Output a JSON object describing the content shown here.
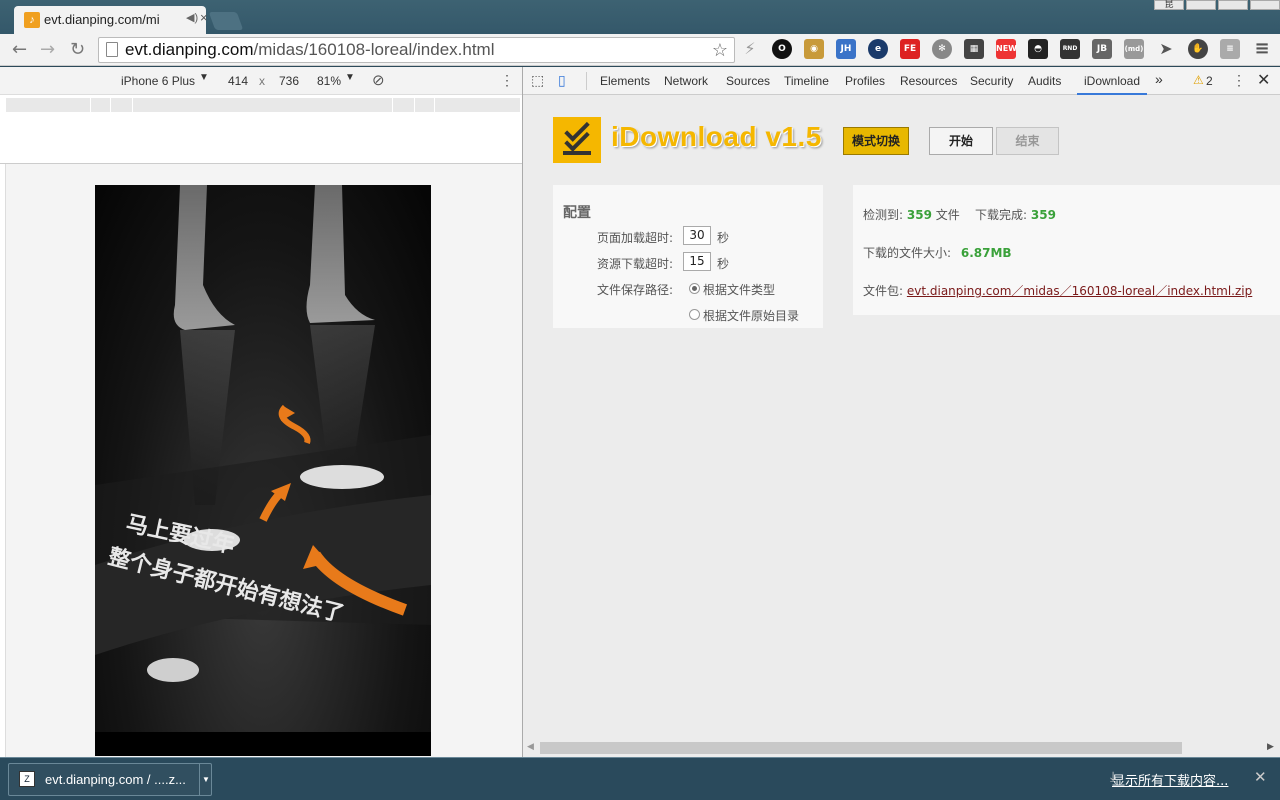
{
  "browser": {
    "tab_title": "evt.dianping.com/mi",
    "url_host": "evt.dianping.com",
    "url_path": "/midas/160108-loreal/index.html",
    "window_label": "昆"
  },
  "device_toolbar": {
    "device": "iPhone 6 Plus",
    "width": "414",
    "times": "x",
    "height": "736",
    "zoom": "81%"
  },
  "phone_content": {
    "line1": "马上要过年",
    "line2": "整个身子都开始有想法了"
  },
  "devtools": {
    "tabs": [
      "Elements",
      "Network",
      "Sources",
      "Timeline",
      "Profiles",
      "Resources",
      "Security",
      "Audits",
      "iDownload"
    ],
    "warning_count": "2"
  },
  "idownload": {
    "title": "iDownload v1.5",
    "mode_button": "模式切换",
    "start_button": "开始",
    "stop_button": "结束",
    "config": {
      "heading": "配置",
      "page_timeout_label": "页面加载超时:",
      "page_timeout_value": "30",
      "unit": "秒",
      "resource_timeout_label": "资源下载超时:",
      "resource_timeout_value": "15",
      "save_path_label": "文件保存路径:",
      "option_by_type": "根据文件类型",
      "option_by_original": "根据文件原始目录"
    },
    "status": {
      "detected_label": "检测到:",
      "detected_count": "359",
      "detected_unit": "文件",
      "done_label": "下载完成:",
      "done_count": "359",
      "size_label": "下载的文件大小:",
      "size_value": "6.87MB",
      "package_label": "文件包:",
      "package_link": "evt.dianping.com／midas／160108-loreal／index.html.zip"
    }
  },
  "download_shelf": {
    "item_name": "evt.dianping.com / ....z...",
    "show_all": "显示所有下载内容..."
  }
}
